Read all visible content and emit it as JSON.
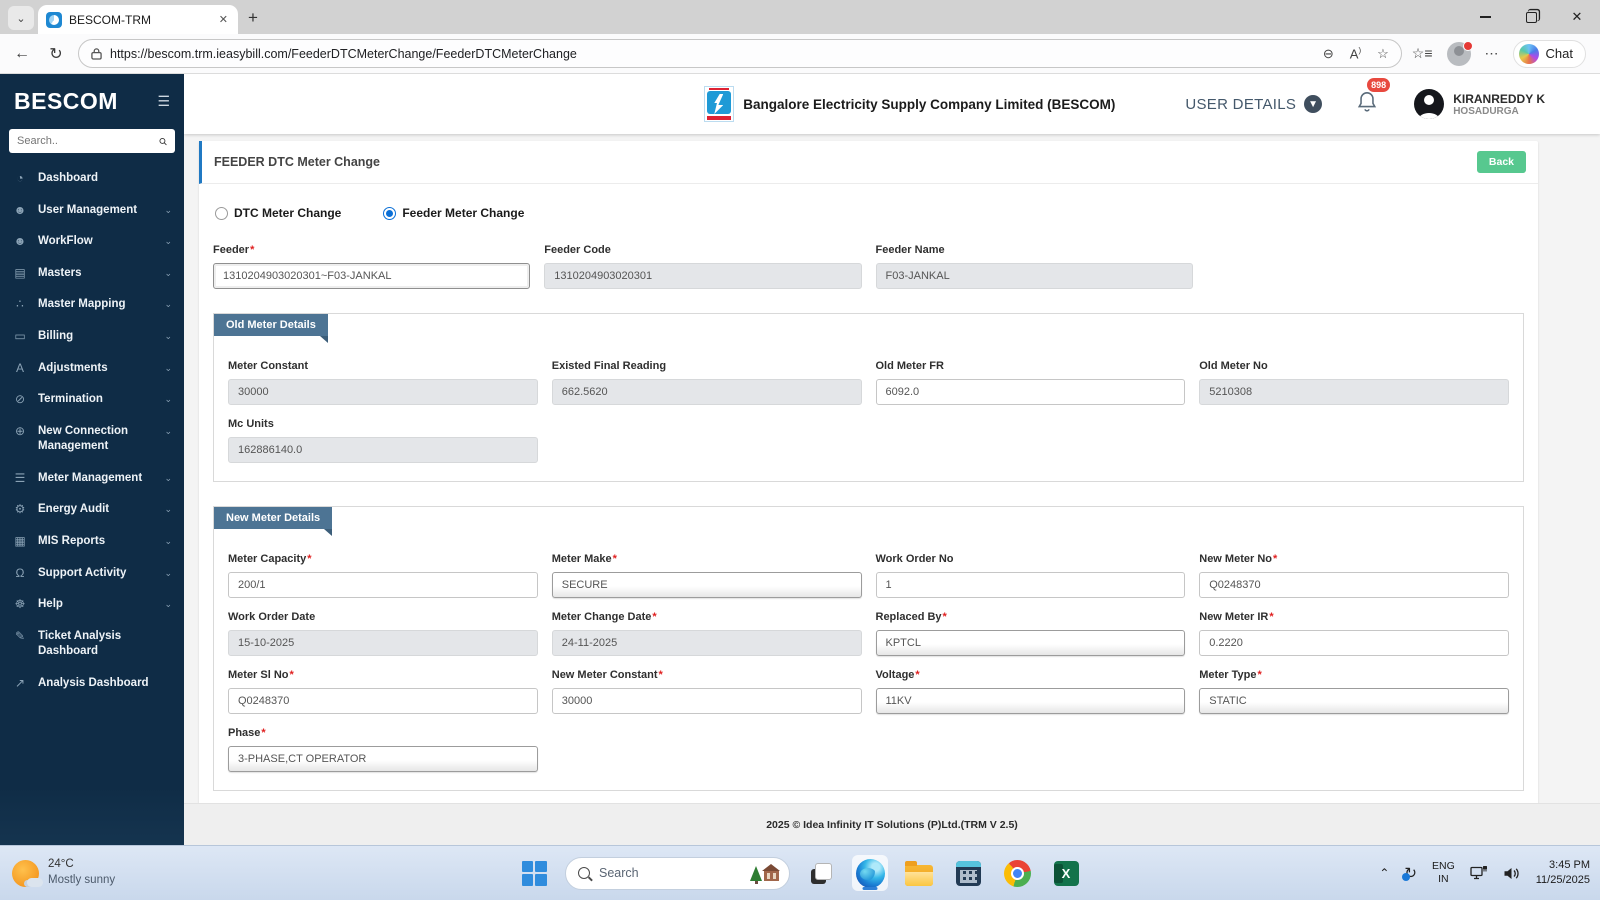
{
  "browser": {
    "tab_title": "BESCOM-TRM",
    "url": "https://bescom.trm.ieasybill.com/FeederDTCMeterChange/FeederDTCMeterChange",
    "chat_label": "Chat"
  },
  "sidebar": {
    "brand": "BESCOM",
    "search_placeholder": "Search..",
    "items": [
      {
        "name": "dashboard",
        "label": "Dashboard",
        "icon": "gauge",
        "chevron": false
      },
      {
        "name": "user-management",
        "label": "User Management",
        "icon": "user",
        "chevron": true
      },
      {
        "name": "workflow",
        "label": "WorkFlow",
        "icon": "user",
        "chevron": true
      },
      {
        "name": "masters",
        "label": "Masters",
        "icon": "layers",
        "chevron": true
      },
      {
        "name": "master-mapping",
        "label": "Master Mapping",
        "icon": "sitemap",
        "chevron": true
      },
      {
        "name": "billing",
        "label": "Billing",
        "icon": "monitor",
        "chevron": true
      },
      {
        "name": "adjustments",
        "label": "Adjustments",
        "icon": "font",
        "chevron": true
      },
      {
        "name": "termination",
        "label": "Termination",
        "icon": "trash",
        "chevron": true
      },
      {
        "name": "new-connection-management",
        "label": "New Connection Management",
        "icon": "plus-circle",
        "chevron": true
      },
      {
        "name": "meter-management",
        "label": "Meter Management",
        "icon": "list",
        "chevron": true
      },
      {
        "name": "energy-audit",
        "label": "Energy Audit",
        "icon": "gears",
        "chevron": true
      },
      {
        "name": "mis-reports",
        "label": "MIS Reports",
        "icon": "bar-chart",
        "chevron": true
      },
      {
        "name": "support-activity",
        "label": "Support Activity",
        "icon": "headset",
        "chevron": true
      },
      {
        "name": "help",
        "label": "Help",
        "icon": "life-ring",
        "chevron": true
      },
      {
        "name": "ticket-analysis-dashboard",
        "label": "Ticket Analysis Dashboard",
        "icon": "paperclip",
        "chevron": false
      },
      {
        "name": "analysis-dashboard",
        "label": "Analysis Dashboard",
        "icon": "line-chart",
        "chevron": false
      }
    ]
  },
  "header": {
    "company": "Bangalore Electricity Supply Company Limited (BESCOM)",
    "user_details_label": "USER DETAILS",
    "notification_count": "898",
    "user_name": "KIRANREDDY K",
    "user_location": "HOSADURGA"
  },
  "page": {
    "title": "FEEDER DTC Meter Change",
    "back_label": "Back",
    "radios": [
      {
        "label": "DTC Meter Change",
        "selected": false
      },
      {
        "label": "Feeder Meter Change",
        "selected": true
      }
    ],
    "feeder_fields": [
      {
        "label": "Feeder",
        "required": true,
        "value": "1310204903020301~F03-JANKAL",
        "kind": "feeder"
      },
      {
        "label": "Feeder Code",
        "required": false,
        "value": "1310204903020301",
        "kind": "disabled"
      },
      {
        "label": "Feeder Name",
        "required": false,
        "value": "F03-JANKAL",
        "kind": "disabled"
      }
    ],
    "old_meter": {
      "title": "Old Meter Details",
      "fields": [
        {
          "label": "Meter Constant",
          "required": false,
          "value": "30000",
          "kind": "disabled"
        },
        {
          "label": "Existed Final Reading",
          "required": false,
          "value": "662.5620",
          "kind": "disabled"
        },
        {
          "label": "Old Meter FR",
          "required": false,
          "value": "6092.0",
          "kind": "text"
        },
        {
          "label": "Old Meter No",
          "required": false,
          "value": "5210308",
          "kind": "disabled"
        },
        {
          "label": "Mc Units",
          "required": false,
          "value": "162886140.0",
          "kind": "disabled"
        }
      ]
    },
    "new_meter": {
      "title": "New Meter Details",
      "fields": [
        {
          "label": "Meter Capacity",
          "required": true,
          "value": "200/1",
          "kind": "text"
        },
        {
          "label": "Meter Make",
          "required": true,
          "value": "SECURE",
          "kind": "select"
        },
        {
          "label": "Work Order No",
          "required": false,
          "value": "1",
          "kind": "text"
        },
        {
          "label": "New Meter No",
          "required": true,
          "value": "Q0248370",
          "kind": "text"
        },
        {
          "label": "Work Order Date",
          "required": false,
          "value": "15-10-2025",
          "kind": "disabled"
        },
        {
          "label": "Meter Change Date",
          "required": true,
          "value": "24-11-2025",
          "kind": "disabled"
        },
        {
          "label": "Replaced By",
          "required": true,
          "value": "KPTCL",
          "kind": "select"
        },
        {
          "label": "New Meter IR",
          "required": true,
          "value": "0.2220",
          "kind": "text"
        },
        {
          "label": "Meter Sl No",
          "required": true,
          "value": "Q0248370",
          "kind": "text"
        },
        {
          "label": "New Meter Constant",
          "required": true,
          "value": "30000",
          "kind": "text"
        },
        {
          "label": "Voltage",
          "required": true,
          "value": "11KV",
          "kind": "select"
        },
        {
          "label": "Meter Type",
          "required": true,
          "value": "STATIC",
          "kind": "select"
        },
        {
          "label": "Phase",
          "required": true,
          "value": "3-PHASE,CT OPERATOR",
          "kind": "select"
        }
      ]
    }
  },
  "footer": {
    "text": "2025 © Idea Infinity IT Solutions (P)Ltd.(TRM V 2.5)"
  },
  "taskbar": {
    "weather_temp": "24°C",
    "weather_desc": "Mostly sunny",
    "search_placeholder": "Search",
    "lang_line1": "ENG",
    "lang_line2": "IN",
    "time": "3:45 PM",
    "date": "11/25/2025"
  }
}
